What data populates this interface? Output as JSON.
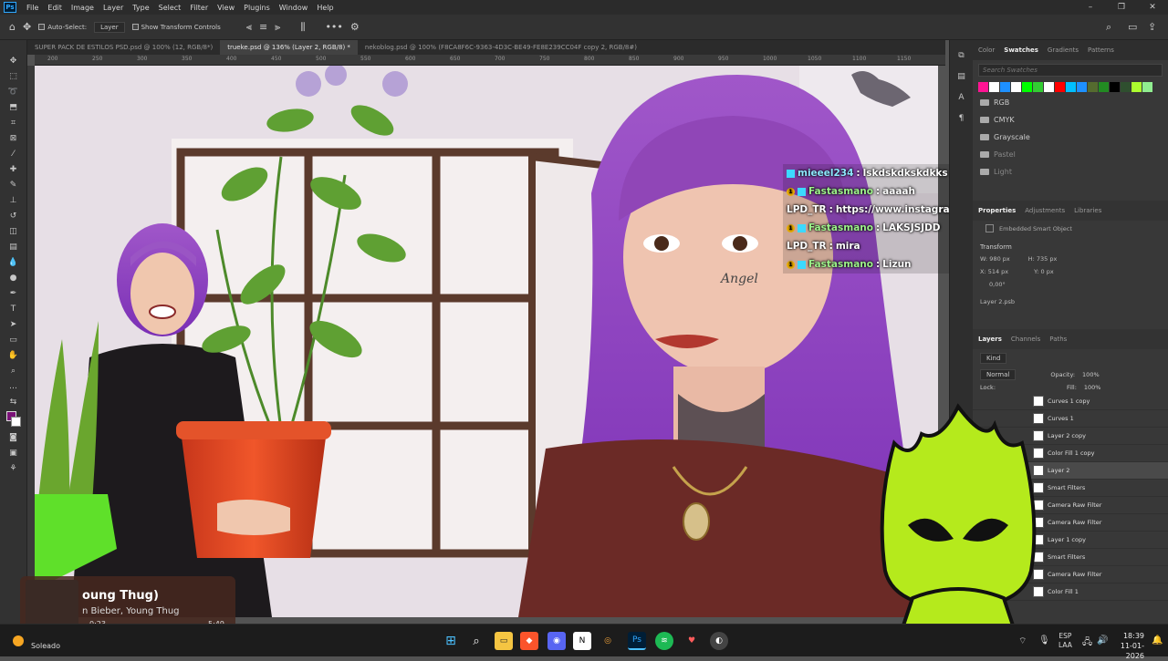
{
  "menu": {
    "items": [
      "File",
      "Edit",
      "Image",
      "Layer",
      "Type",
      "Select",
      "Filter",
      "View",
      "Plugins",
      "Window",
      "Help"
    ]
  },
  "options": {
    "auto_select": "Auto-Select:",
    "layer_select": "Layer",
    "show_transform": "Show Transform Controls"
  },
  "tabs": [
    {
      "label": "SUPER PACK DE ESTILOS PSD.psd @ 100% (12, RGB/8*)"
    },
    {
      "label": "trueke.psd @ 136% (Layer 2, RGB/8) *"
    },
    {
      "label": "nekoblog.psd @ 100% (F8CA8F6C-9363-4D3C-BE49-FE8E239CC04F copy 2, RGB/8#)"
    }
  ],
  "ruler": {
    "ticks": [
      "200",
      "250",
      "300",
      "350",
      "400",
      "450",
      "500",
      "550",
      "600",
      "650",
      "700",
      "750",
      "800",
      "850",
      "900",
      "950",
      "1000",
      "1050",
      "1100",
      "1150"
    ]
  },
  "swatches": {
    "tabs": [
      "Color",
      "Swatches",
      "Gradients",
      "Patterns"
    ],
    "search_placeholder": "Search Swatches",
    "colors": [
      "#ff1493",
      "#ffffff",
      "#1e90ff",
      "#ffffff",
      "#00ff00",
      "#32cd32",
      "#ffffff",
      "#ff0000",
      "#00bfff",
      "#1e90ff",
      "#556b2f",
      "#228b22",
      "#000000",
      "#2f4f2f",
      "#adff2f",
      "#90ee90"
    ],
    "folders": [
      "RGB",
      "CMYK",
      "Grayscale",
      "Pastel",
      "Light"
    ]
  },
  "properties": {
    "tabs": [
      "Properties",
      "Adjustments",
      "Libraries"
    ],
    "object": "Embedded Smart Object",
    "transform_label": "Transform",
    "w": "W: 980 px",
    "h": "H: 735 px",
    "x": "X: 514 px",
    "y": "Y: 0 px",
    "angle": "0,00°",
    "file": "Layer 2.psb"
  },
  "layers": {
    "tabs": [
      "Layers",
      "Channels",
      "Paths"
    ],
    "kind": "Kind",
    "blend": "Normal",
    "opacity_label": "Opacity:",
    "opacity": "100%",
    "lock_label": "Lock:",
    "fill_label": "Fill:",
    "fill": "100%",
    "rows": [
      "Curves 1 copy",
      "Curves 1",
      "Layer 2 copy",
      "Color Fill 1 copy",
      "Layer 2",
      "Smart Filters",
      "Camera Raw Filter",
      "Camera Raw Filter",
      "Layer 1 copy",
      "Smart Filters",
      "Camera Raw Filter",
      "Color Fill 1"
    ]
  },
  "chat": [
    {
      "user": "mieeel234",
      "sep": " : ",
      "msg": "lskdskdkskdkks",
      "badges": [
        "twitch"
      ]
    },
    {
      "user": "Fastasmano",
      "sep": " : ",
      "msg": "aaaah",
      "badges": [
        "bits",
        "twitch"
      ]
    },
    {
      "user": "LPD_TR",
      "sep": " : ",
      "msg": "https://www.instagram.com/p/DTHVJGSlp-C/",
      "badges": []
    },
    {
      "user": "Fastasmano",
      "sep": " : ",
      "msg": "LAKSJSJDD",
      "badges": [
        "bits",
        "twitch"
      ]
    },
    {
      "user": "LPD_TR",
      "sep": " : ",
      "msg": "mira",
      "badges": []
    },
    {
      "user": "Fastasmano",
      "sep": " : ",
      "msg": "Lizun",
      "badges": [
        "bits",
        "twitch"
      ]
    }
  ],
  "music": {
    "title": "oung Thug)",
    "artist": "n Bieber, Young Thug",
    "elapsed": "0:23",
    "duration": "5:49",
    "progress": 0.07
  },
  "canvas_text": {
    "tattoo": "Angel"
  },
  "taskbar": {
    "weather": "Soleado",
    "lang": "ESP",
    "layout": "LAA",
    "time": "18:39",
    "date": "11-01-2026"
  }
}
